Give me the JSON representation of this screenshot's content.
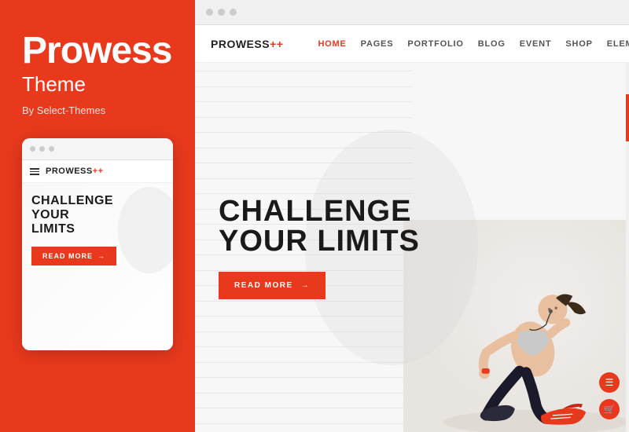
{
  "sidebar": {
    "title": "Prowess",
    "subtitle": "Theme",
    "author": "By Select-Themes",
    "mobile_preview": {
      "logo": "PROWESS",
      "logo_plus": "++",
      "heading_line1": "CHALLENGE",
      "heading_line2": "YOUR",
      "heading_line3": "LIMITS",
      "btn_label": "READ MORE"
    }
  },
  "website": {
    "logo": "PROWESS",
    "logo_plus": "++",
    "nav": [
      {
        "label": "HOME",
        "active": true
      },
      {
        "label": "PAGES",
        "active": false
      },
      {
        "label": "PORTFOLIO",
        "active": false
      },
      {
        "label": "BLOG",
        "active": false
      },
      {
        "label": "EVENT",
        "active": false
      },
      {
        "label": "SHOP",
        "active": false
      },
      {
        "label": "ELEMENTS",
        "active": false
      }
    ],
    "hero": {
      "heading_line1": "CHALLENGE",
      "heading_line2": "YOUR LIMITS",
      "btn_label": "READ MORE"
    }
  },
  "colors": {
    "accent": "#e8391d",
    "dark": "#1a1a1a",
    "white": "#ffffff",
    "light_gray": "#f7f7f7"
  },
  "icons": {
    "arrow": "→",
    "search": "🔍",
    "cart": "🛒",
    "menu": "☰"
  }
}
